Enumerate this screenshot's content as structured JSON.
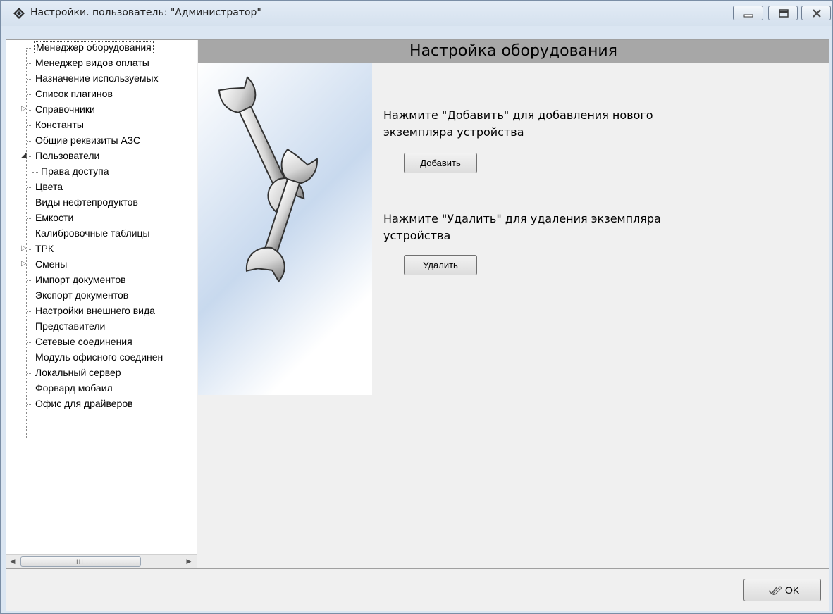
{
  "window": {
    "title": "Настройки. пользователь: \"Администратор\""
  },
  "tree": {
    "items": [
      {
        "label": "Менеджер оборудования",
        "selected": true
      },
      {
        "label": "Менеджер видов оплаты"
      },
      {
        "label": "Назначение используемых"
      },
      {
        "label": "Список плагинов"
      },
      {
        "label": "Справочники",
        "expander": "collapsed"
      },
      {
        "label": "Константы"
      },
      {
        "label": "Общие реквизиты АЗС"
      },
      {
        "label": "Пользователи",
        "expander": "expanded"
      },
      {
        "label": "Права доступа",
        "child": true
      },
      {
        "label": "Цвета"
      },
      {
        "label": "Виды нефтепродуктов"
      },
      {
        "label": "Емкости"
      },
      {
        "label": "Калибровочные таблицы"
      },
      {
        "label": "ТРК",
        "expander": "collapsed"
      },
      {
        "label": "Смены",
        "expander": "collapsed"
      },
      {
        "label": "Импорт документов"
      },
      {
        "label": "Экспорт документов"
      },
      {
        "label": "Настройки внешнего вида"
      },
      {
        "label": "Представители"
      },
      {
        "label": "Сетевые соединения"
      },
      {
        "label": "Модуль офисного соединен"
      },
      {
        "label": "Локальный сервер"
      },
      {
        "label": "Форвард мобаил"
      },
      {
        "label": "Офис для драйверов"
      }
    ]
  },
  "main": {
    "header": "Настройка оборудования",
    "add_line1": "Нажмите \"Добавить\" для добавления нового",
    "add_line2": "экземпляра устройства",
    "add_button": "Добавить",
    "remove_line1": "Нажмите \"Удалить\" для удаления экземпляра",
    "remove_line2": "устройства",
    "remove_button": "Удалить",
    "image_icon": "wrenches-icon"
  },
  "footer": {
    "ok_button": "OK"
  },
  "scroll": {
    "grip": "III"
  },
  "icons": {
    "app": "app-diamond-icon",
    "minimize": "minimize-icon",
    "maximize": "maximize-icon",
    "close": "close-icon",
    "ok": "checkmark-pen-icon"
  },
  "colors": {
    "header_bar": "#a7a7a7",
    "window_frame": "#dbe6f2",
    "panel": "#f0f0f0"
  }
}
